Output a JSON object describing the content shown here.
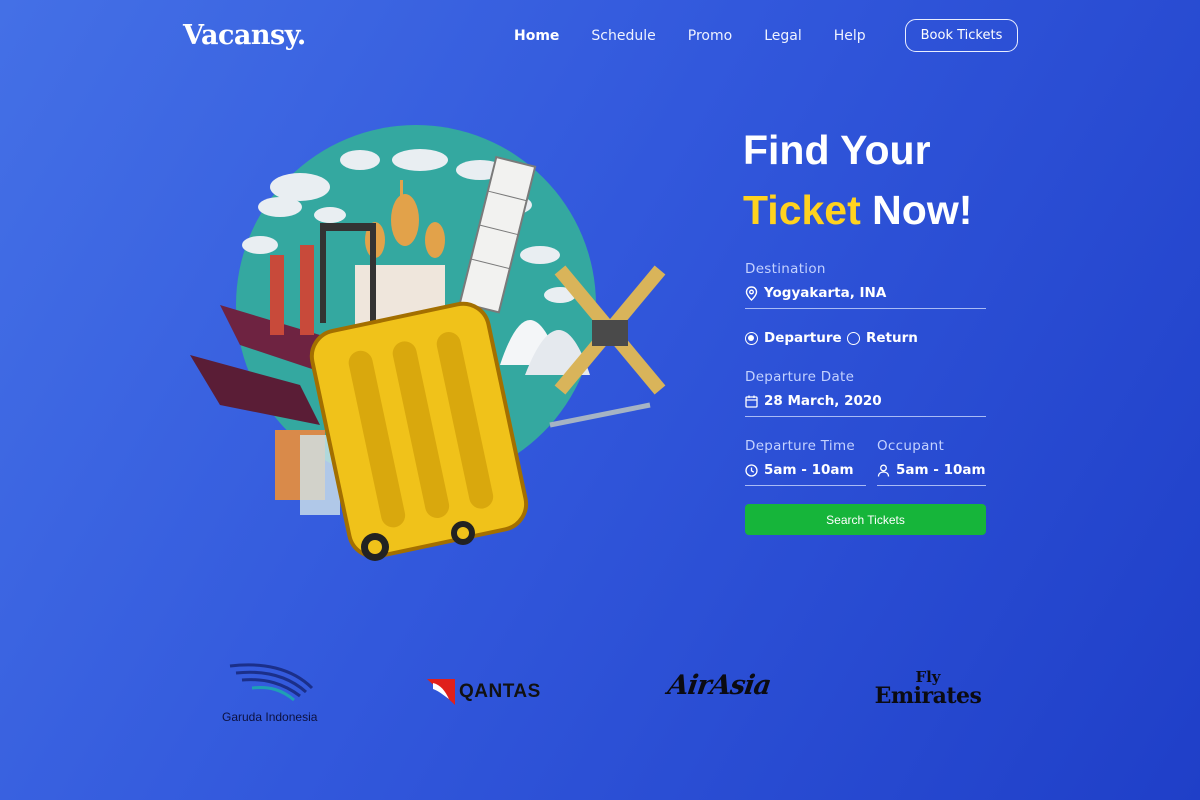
{
  "brand": {
    "name": "Vacansy."
  },
  "nav": {
    "items": [
      {
        "label": "Home",
        "active": true
      },
      {
        "label": "Schedule",
        "active": false
      },
      {
        "label": "Promo",
        "active": false
      },
      {
        "label": "Legal",
        "active": false
      },
      {
        "label": "Help",
        "active": false
      }
    ],
    "cta_label": "Book Tickets"
  },
  "hero": {
    "headline_line1": "Find Your",
    "headline_highlight": "Ticket",
    "headline_rest": "Now!",
    "highlight_color": "#ffd21f"
  },
  "form": {
    "destination": {
      "label": "Destination",
      "value": "Yogyakarta, INA",
      "icon": "location-pin-icon"
    },
    "trip_type": {
      "options": [
        {
          "label": "Departure",
          "selected": true
        },
        {
          "label": "Return",
          "selected": false
        }
      ]
    },
    "departure_date": {
      "label": "Departure Date",
      "value": "28 March, 2020",
      "icon": "calendar-icon"
    },
    "departure_time": {
      "label": "Departure Time",
      "value": "5am - 10am",
      "icon": "clock-icon"
    },
    "occupant": {
      "label": "Occupant",
      "value": "5am - 10am",
      "icon": "person-icon"
    },
    "submit_label": "Search Tickets",
    "submit_color": "#16b53a"
  },
  "partners": {
    "garuda": {
      "name": "Garuda Indonesia"
    },
    "qantas": {
      "name": "QANTAS"
    },
    "airasia": {
      "name": "AirAsia"
    },
    "emirates": {
      "line1": "Fly",
      "line2": "Emirates"
    }
  },
  "colors": {
    "background_start": "#4470e6",
    "background_end": "#1f3fc8"
  }
}
